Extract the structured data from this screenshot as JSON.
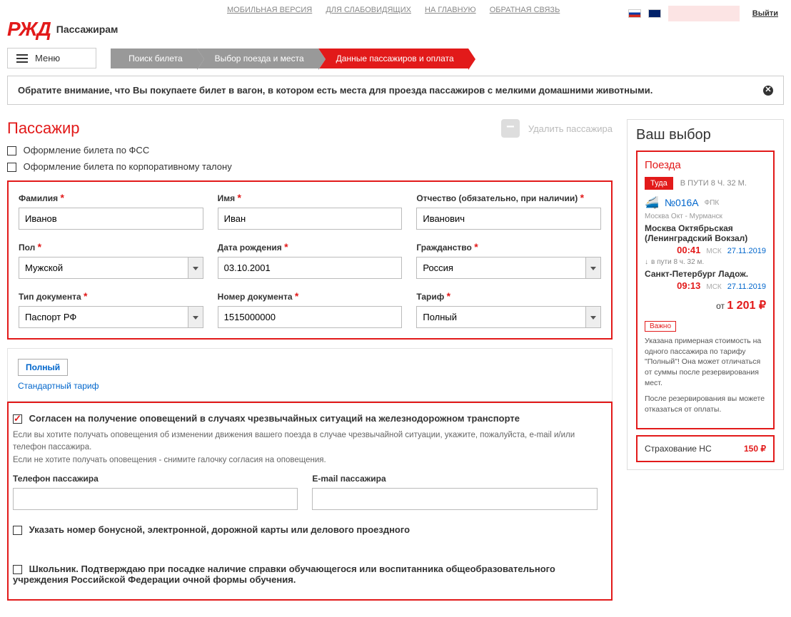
{
  "top": {
    "mobile": "МОБИЛЬНАЯ ВЕРСИЯ",
    "accessibility": "ДЛЯ СЛАБОВИДЯЩИХ",
    "home": "НА ГЛАВНУЮ",
    "feedback": "ОБРАТНАЯ СВЯЗЬ",
    "exit": "Выйти"
  },
  "header": {
    "logo": "РЖД",
    "subtitle": "Пассажирам",
    "menu": "Меню"
  },
  "breadcrumb": {
    "step1": "Поиск билета",
    "step2": "Выбор поезда и места",
    "step3": "Данные пассажиров и оплата"
  },
  "notice": "Обратите внимание, что Вы покупаете билет в вагон, в котором есть места для проезда пассажиров с мелкими домашними животными.",
  "passenger": {
    "title": "Пассажир",
    "remove": "Удалить пассажира",
    "fss_chk": "Оформление билета по ФСС",
    "corp_chk": "Оформление билета по корпоративному талону"
  },
  "form": {
    "surname_label": "Фамилия",
    "surname": "Иванов",
    "name_label": "Имя",
    "name": "Иван",
    "patronymic_label": "Отчество (обязательно, при наличии)",
    "patronymic": "Иванович",
    "gender_label": "Пол",
    "gender": "Мужской",
    "dob_label": "Дата рождения",
    "dob": "03.10.2001",
    "citizenship_label": "Гражданство",
    "citizenship": "Россия",
    "doctype_label": "Тип документа",
    "doctype": "Паспорт РФ",
    "docnum_label": "Номер документа",
    "docnum": "1515000000",
    "tariff_label": "Тариф",
    "tariff": "Полный"
  },
  "tariff_box": {
    "full": "Полный",
    "standard": "Стандартный тариф"
  },
  "consent": {
    "chk": "Согласен на получение оповещений в случаях чрезвычайных ситуаций на железнодорожном транспорте",
    "note": "Если вы хотите получать оповещения об изменении движения вашего поезда в случае чрезвычайной ситуации, укажите, пожалуйста, e-mail и/или телефон пассажира.\nЕсли не хотите получать оповещения - снимите галочку согласия на оповещения.",
    "phone_label": "Телефон пассажира",
    "email_label": "E-mail пассажира",
    "bonus_chk": "Указать номер бонусной, электронной, дорожной карты или делового проездного",
    "school_chk": "Школьник. Подтверждаю при посадке наличие справки обучающегося или воспитанника общеобразовательного учреждения Российской Федерации очной формы обучения."
  },
  "side": {
    "title": "Ваш выбор",
    "trains": "Поезда",
    "dir": "Туда",
    "travel_time": "В ПУТИ 8 Ч. 32 М.",
    "train_num": "№016А",
    "carrier": "ФПК",
    "route": "Москва Окт - Мурманск",
    "station1": "Москва Октябрьская (Ленинградский Вокзал)",
    "time1": "00:41",
    "msk": "МСК",
    "date1": "27.11.2019",
    "mid": "в пути  8 ч. 32 м.",
    "station2": "Санкт-Петербург Ладож.",
    "time2": "09:13",
    "date2": "27.11.2019",
    "price_from": "от",
    "price": "1 201 ₽",
    "important": "Важно",
    "note1": "Указана примерная стоимость на одного пассажира по тарифу \"Полный\"! Она может отличаться от суммы после резервирования мест.",
    "note2": "После резервирования вы можете отказаться от оплаты.",
    "insurance": "Страхование НС",
    "insurance_price": "150 ₽"
  }
}
